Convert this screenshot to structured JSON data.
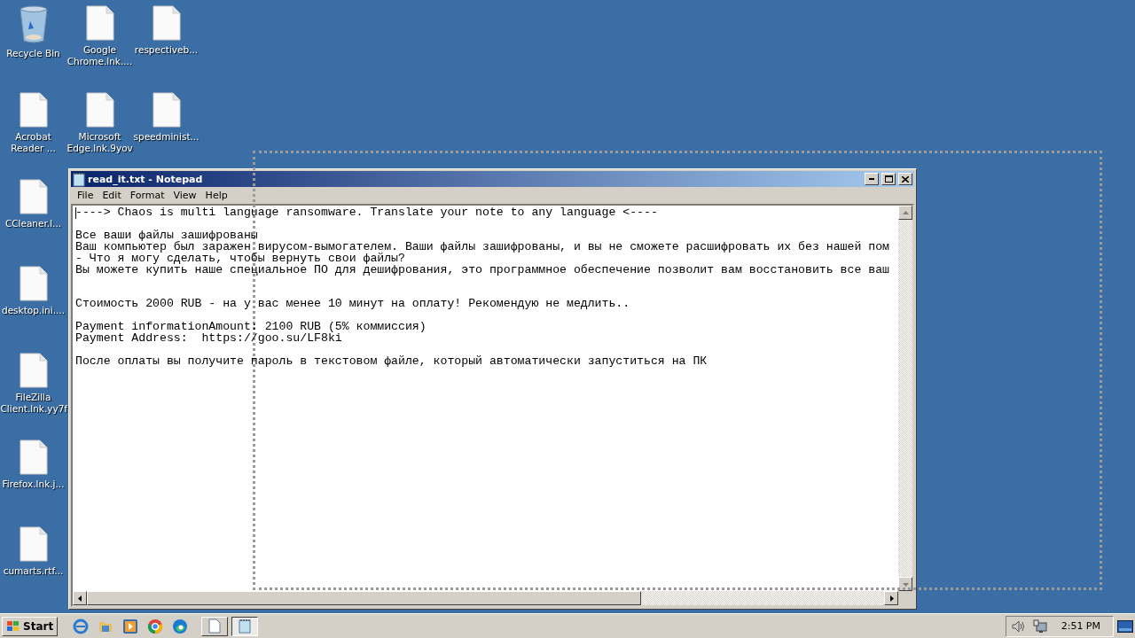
{
  "desktop_icons": [
    [
      {
        "kind": "bin",
        "label": "Recycle Bin"
      },
      {
        "kind": "file",
        "label": "Acrobat Reader ..."
      },
      {
        "kind": "file",
        "label": "CCleaner.l..."
      },
      {
        "kind": "file",
        "label": "desktop.ini...."
      },
      {
        "kind": "file",
        "label": "FileZilla Client.lnk.yy7f"
      },
      {
        "kind": "file",
        "label": "Firefox.lnk.j..."
      },
      {
        "kind": "file",
        "label": "cumarts.rtf..."
      }
    ],
    [
      {
        "kind": "file",
        "label": "Google Chrome.lnk...."
      },
      {
        "kind": "file",
        "label": "Microsoft Edge.lnk.9yov"
      }
    ],
    [
      {
        "kind": "file",
        "label": "respectiveb..."
      },
      {
        "kind": "file",
        "label": "speedminist..."
      }
    ]
  ],
  "window": {
    "title": "read_it.txt - Notepad",
    "menu": [
      "File",
      "Edit",
      "Format",
      "View",
      "Help"
    ],
    "text": "----> Chaos is multi language ransomware. Translate your note to any language <----\n\nВсе ваши файлы зашифрованы\nВаш компьютер был заражен вирусом-вымогателем. Ваши файлы зашифрованы, и вы не сможете расшифровать их без нашей пом\n- Что я могу сделать, чтобы вернуть свои файлы?\nВы можете купить наше специальное ПО для дешифрования, это программное обеспечение позволит вам восстановить все ваш\n\n\nСтоимость 2000 RUB - на у вас менее 10 минут на оплату! Рекомендую не медлить..\n\nPayment informationAmount: 2100 RUB (5% коммиссия)\nPayment Address:  https://goo.su/LF8ki\n\nПосле оплаты вы получите пароль в текстовом файле, который автоматически запуститься на ПК"
  },
  "taskbar": {
    "start": "Start",
    "quick_launch": [
      {
        "kind": "ie"
      },
      {
        "kind": "explorer"
      },
      {
        "kind": "media"
      },
      {
        "kind": "chrome"
      },
      {
        "kind": "edge"
      }
    ],
    "tasks": [
      {
        "kind": "document",
        "selected": false
      },
      {
        "kind": "notepad",
        "selected": true
      }
    ],
    "clock": "2:51 PM"
  }
}
